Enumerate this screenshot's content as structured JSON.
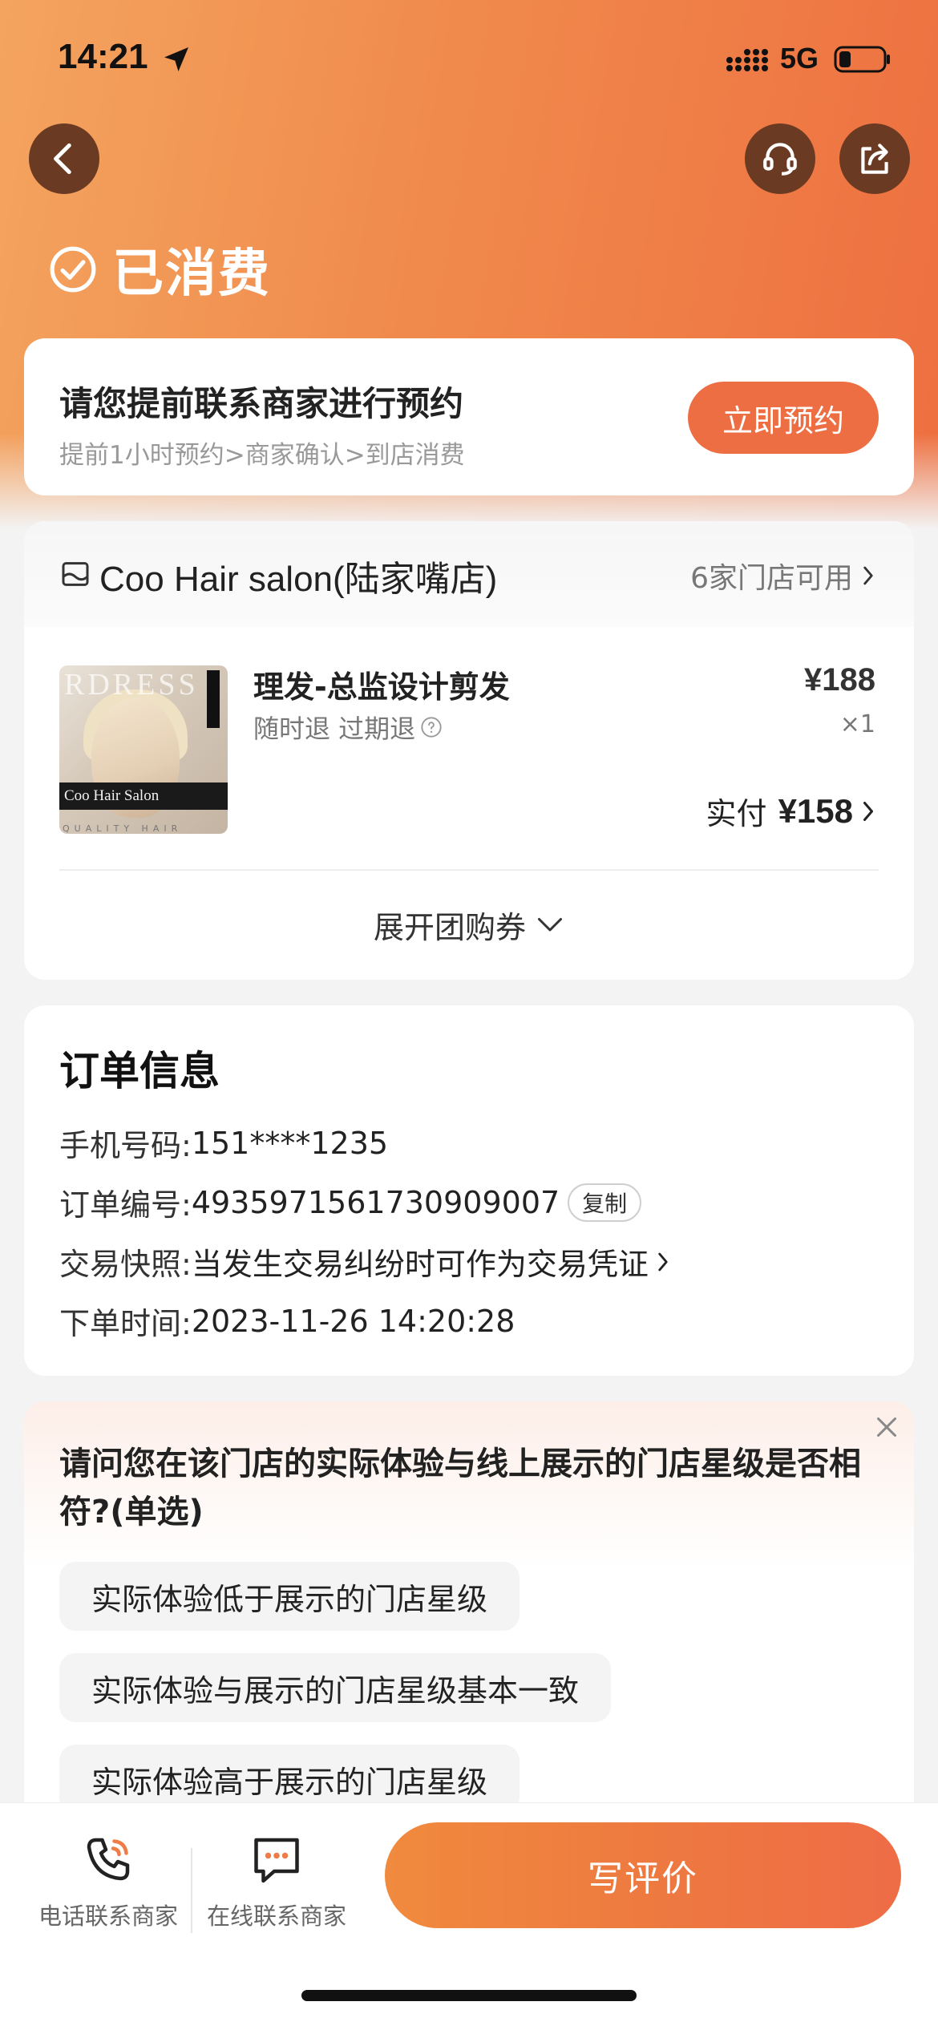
{
  "status_bar": {
    "time": "14:21",
    "network": "5G"
  },
  "header": {
    "state_label": "已消费"
  },
  "reservation": {
    "title": "请您提前联系商家进行预约",
    "subtitle": "提前1小时预约>商家确认>到店消费",
    "button_label": "立即预约"
  },
  "shop": {
    "name": "Coo Hair salon(陆家嘴店)",
    "stores_available": "6家门店可用"
  },
  "product": {
    "thumbnail_text": "Coo Hair Salon",
    "thumbnail_watermark": "RDRESS",
    "thumbnail_tagline": "QUALITY HAIR",
    "name": "理发-总监设计剪发",
    "tags": "随时退 过期退",
    "price": "¥188",
    "quantity": "×1",
    "paid_label": "实付",
    "paid_amount": "¥158",
    "expand_label": "展开团购券"
  },
  "order": {
    "title": "订单信息",
    "phone_key": "手机号码:",
    "phone_value": "151****1235",
    "order_no_key": "订单编号:",
    "order_no_value": "4935971561730909007",
    "copy_label": "复制",
    "snapshot_key": "交易快照:",
    "snapshot_value": "当发生交易纠纷时可作为交易凭证",
    "time_key": "下单时间:",
    "time_value": "2023-11-26 14:20:28"
  },
  "survey": {
    "question": "请问您在该门店的实际体验与线上展示的门店星级是否相符?(单选)",
    "options": [
      "实际体验低于展示的门店星级",
      "实际体验与展示的门店星级基本一致",
      "实际体验高于展示的门店星级"
    ]
  },
  "bottom_bar": {
    "phone_label": "电话联系商家",
    "chat_label": "在线联系商家",
    "review_label": "写评价"
  },
  "colors": {
    "brand_orange": "#ee6e44",
    "gradient_start": "#f4a45f",
    "gradient_end": "#ee6f40"
  },
  "icons": [
    "location-arrow-icon",
    "signal-icon",
    "battery-icon",
    "back-icon",
    "customer-service-icon",
    "share-icon",
    "check-circle-icon",
    "shop-icon",
    "chevron-right-icon",
    "question-icon",
    "chevron-down-icon",
    "close-icon",
    "phone-icon",
    "chat-icon"
  ]
}
